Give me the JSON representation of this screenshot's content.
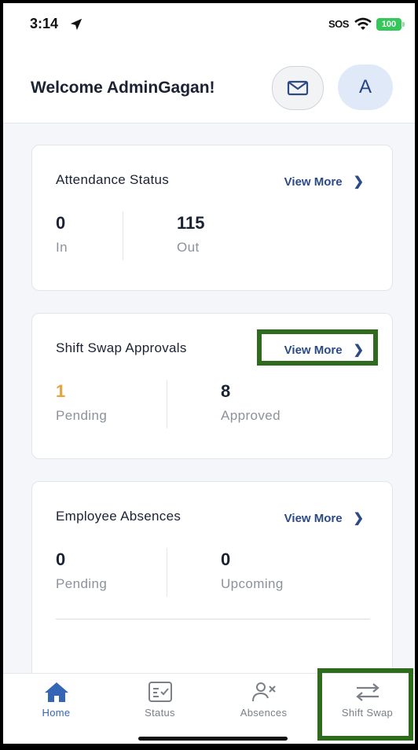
{
  "status_bar": {
    "time": "3:14",
    "sos": "SOS",
    "battery": "100"
  },
  "header": {
    "welcome": "Welcome AdminGagan!",
    "avatar_initial": "A"
  },
  "attendance": {
    "title": "Attendance Status",
    "view_more": "View More",
    "in_value": "0",
    "in_label": "In",
    "out_value": "115",
    "out_label": "Out"
  },
  "shift_swap": {
    "title": "Shift Swap Approvals",
    "view_more": "View More",
    "pending_value": "1",
    "pending_label": "Pending",
    "approved_value": "8",
    "approved_label": "Approved"
  },
  "absences": {
    "title": "Employee Absences",
    "view_more": "View More",
    "pending_value": "0",
    "pending_label": "Pending",
    "upcoming_value": "0",
    "upcoming_label": "Upcoming"
  },
  "tabs": [
    {
      "label": "Home",
      "icon": "home-icon",
      "active": true
    },
    {
      "label": "Status",
      "icon": "status-icon",
      "active": false
    },
    {
      "label": "Absences",
      "icon": "absences-icon",
      "active": false
    },
    {
      "label": "Shift Swap",
      "icon": "swap-icon",
      "active": false
    }
  ],
  "colors": {
    "accent": "#3466b5",
    "link": "#2c4a86",
    "pending": "#e6a23c",
    "highlight": "#2e6b1d"
  }
}
